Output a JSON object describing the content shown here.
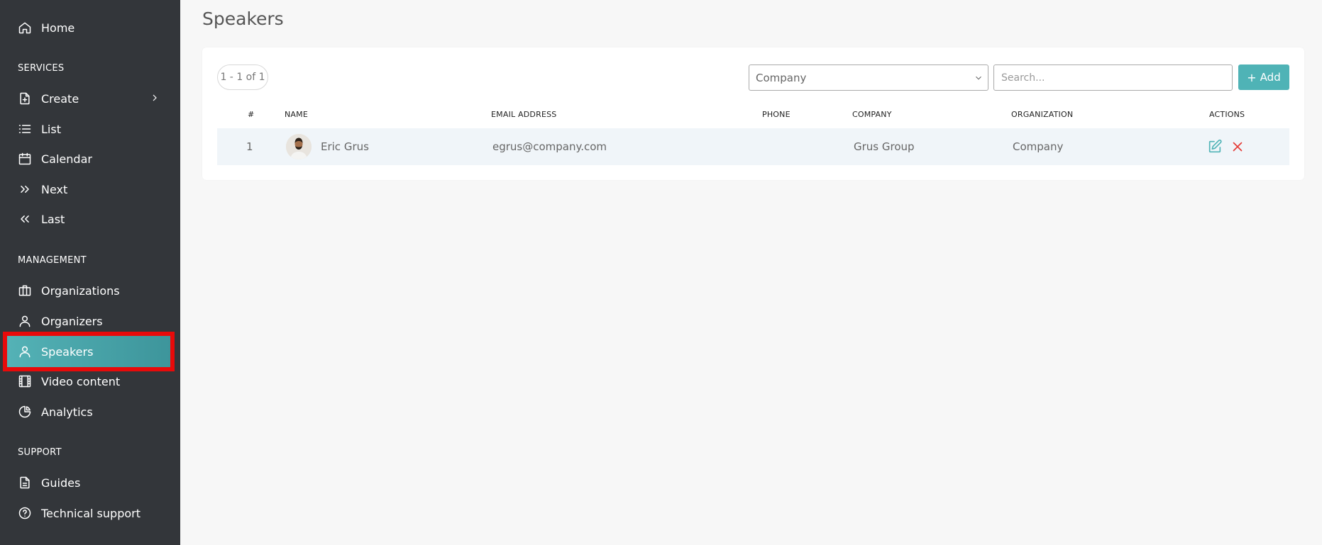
{
  "sidebar": {
    "home": "Home",
    "sections": {
      "services": "SERVICES",
      "management": "MANAGEMENT",
      "support": "SUPPORT"
    },
    "services_items": [
      "Create",
      "List",
      "Calendar",
      "Next",
      "Last"
    ],
    "management_items": [
      "Organizations",
      "Organizers",
      "Speakers",
      "Video content",
      "Analytics"
    ],
    "support_items": [
      "Guides",
      "Technical support"
    ],
    "active_item": "Speakers"
  },
  "page": {
    "title": "Speakers"
  },
  "toolbar": {
    "pager": "1 - 1 of 1",
    "company_select_value": "Company",
    "search_placeholder": "Search...",
    "add_label": "Add"
  },
  "table": {
    "headers": [
      "#",
      "NAME",
      "EMAIL ADDRESS",
      "PHONE",
      "COMPANY",
      "ORGANIZATION",
      "ACTIONS"
    ],
    "rows": [
      {
        "index": "1",
        "name": "Eric Grus",
        "email": "egrus@company.com",
        "phone": "",
        "company": "Grus Group",
        "organization": "Company"
      }
    ]
  },
  "colors": {
    "sidebar_bg": "#33363a",
    "accent": "#4fb3b6",
    "delete": "#e53935",
    "highlight": "#e80a0a"
  }
}
